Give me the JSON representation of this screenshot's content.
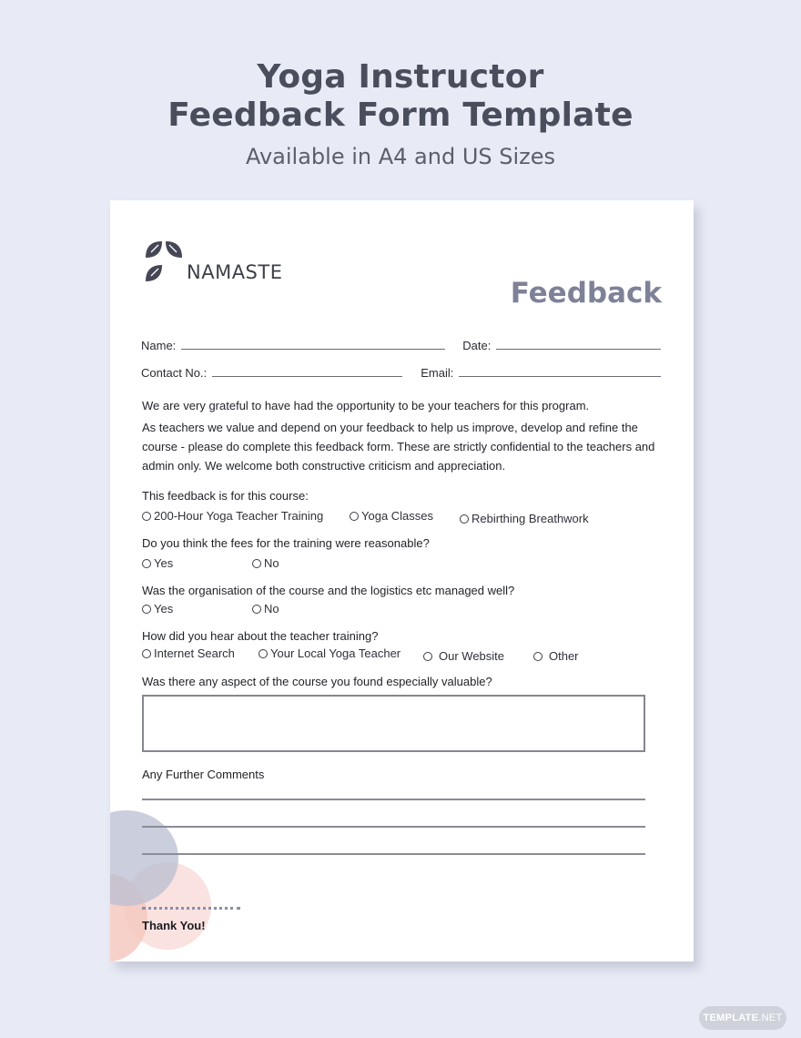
{
  "hero": {
    "title_line1": "Yoga Instructor",
    "title_line2": "Feedback Form Template",
    "subtitle": "Available in A4 and US Sizes"
  },
  "document": {
    "brand": {
      "logo_icon": "lotus-petals-icon",
      "name": "NAMASTE"
    },
    "title": "Feedback",
    "fields": {
      "name_label": "Name:",
      "date_label": "Date:",
      "contact_label": "Contact No.:",
      "email_label": "Email:"
    },
    "intro": {
      "line1": "We are very grateful to have had the opportunity to be your teachers for this program.",
      "paragraph": "As teachers we value and depend on your feedback to help us improve, develop and refine the course - please do complete this feedback form. These are strictly confidential to the teachers and admin only. We welcome both constructive criticism and appreciation."
    },
    "questions": [
      {
        "text": "This feedback is for this course:",
        "options": [
          "200-Hour Yoga Teacher Training",
          "Yoga Classes",
          "Rebirthing Breathwork"
        ]
      },
      {
        "text": "Do you think the fees for the training were reasonable?",
        "options": [
          "Yes",
          "No"
        ]
      },
      {
        "text": "Was the organisation of the course and the logistics etc managed well?",
        "options": [
          "Yes",
          "No"
        ]
      },
      {
        "text": "How did you hear about the teacher training?",
        "options": [
          "Internet Search",
          "Your Local Yoga Teacher",
          "Our Website",
          "Other"
        ]
      },
      {
        "text": "Was there any aspect of the course you found especially valuable?"
      }
    ],
    "comments_label": "Any Further Comments",
    "thanks": "Thank You!",
    "colors": {
      "accent_circle_blue": "#c3c6d8",
      "accent_circle_pink": "#f7d8d6",
      "accent_circle_salmon": "#f5cfc7"
    }
  },
  "watermark": {
    "bold": "TEMPLATE",
    "light": ".NET"
  }
}
